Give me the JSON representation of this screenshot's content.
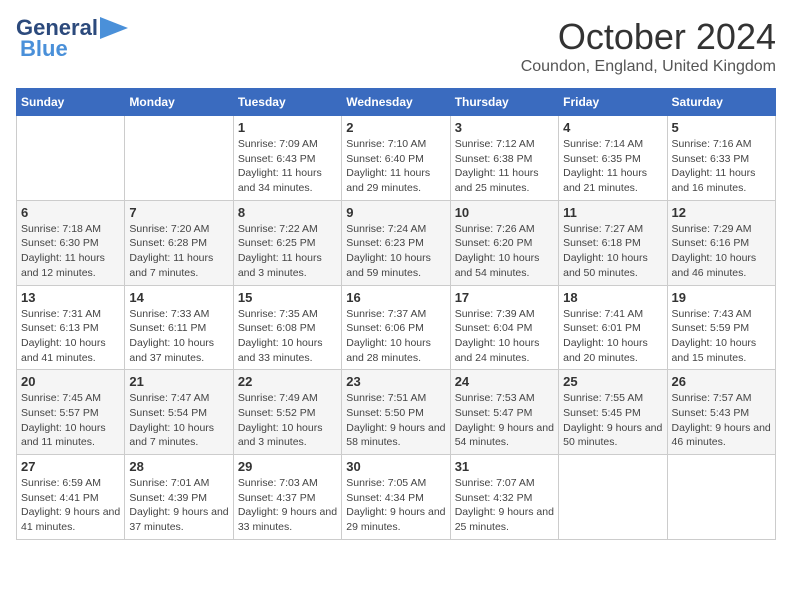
{
  "header": {
    "logo_line1": "General",
    "logo_line2": "Blue",
    "month_title": "October 2024",
    "location": "Coundon, England, United Kingdom"
  },
  "weekdays": [
    "Sunday",
    "Monday",
    "Tuesday",
    "Wednesday",
    "Thursday",
    "Friday",
    "Saturday"
  ],
  "weeks": [
    [
      {
        "day": "",
        "sunrise": "",
        "sunset": "",
        "daylight": ""
      },
      {
        "day": "",
        "sunrise": "",
        "sunset": "",
        "daylight": ""
      },
      {
        "day": "1",
        "sunrise": "Sunrise: 7:09 AM",
        "sunset": "Sunset: 6:43 PM",
        "daylight": "Daylight: 11 hours and 34 minutes."
      },
      {
        "day": "2",
        "sunrise": "Sunrise: 7:10 AM",
        "sunset": "Sunset: 6:40 PM",
        "daylight": "Daylight: 11 hours and 29 minutes."
      },
      {
        "day": "3",
        "sunrise": "Sunrise: 7:12 AM",
        "sunset": "Sunset: 6:38 PM",
        "daylight": "Daylight: 11 hours and 25 minutes."
      },
      {
        "day": "4",
        "sunrise": "Sunrise: 7:14 AM",
        "sunset": "Sunset: 6:35 PM",
        "daylight": "Daylight: 11 hours and 21 minutes."
      },
      {
        "day": "5",
        "sunrise": "Sunrise: 7:16 AM",
        "sunset": "Sunset: 6:33 PM",
        "daylight": "Daylight: 11 hours and 16 minutes."
      }
    ],
    [
      {
        "day": "6",
        "sunrise": "Sunrise: 7:18 AM",
        "sunset": "Sunset: 6:30 PM",
        "daylight": "Daylight: 11 hours and 12 minutes."
      },
      {
        "day": "7",
        "sunrise": "Sunrise: 7:20 AM",
        "sunset": "Sunset: 6:28 PM",
        "daylight": "Daylight: 11 hours and 7 minutes."
      },
      {
        "day": "8",
        "sunrise": "Sunrise: 7:22 AM",
        "sunset": "Sunset: 6:25 PM",
        "daylight": "Daylight: 11 hours and 3 minutes."
      },
      {
        "day": "9",
        "sunrise": "Sunrise: 7:24 AM",
        "sunset": "Sunset: 6:23 PM",
        "daylight": "Daylight: 10 hours and 59 minutes."
      },
      {
        "day": "10",
        "sunrise": "Sunrise: 7:26 AM",
        "sunset": "Sunset: 6:20 PM",
        "daylight": "Daylight: 10 hours and 54 minutes."
      },
      {
        "day": "11",
        "sunrise": "Sunrise: 7:27 AM",
        "sunset": "Sunset: 6:18 PM",
        "daylight": "Daylight: 10 hours and 50 minutes."
      },
      {
        "day": "12",
        "sunrise": "Sunrise: 7:29 AM",
        "sunset": "Sunset: 6:16 PM",
        "daylight": "Daylight: 10 hours and 46 minutes."
      }
    ],
    [
      {
        "day": "13",
        "sunrise": "Sunrise: 7:31 AM",
        "sunset": "Sunset: 6:13 PM",
        "daylight": "Daylight: 10 hours and 41 minutes."
      },
      {
        "day": "14",
        "sunrise": "Sunrise: 7:33 AM",
        "sunset": "Sunset: 6:11 PM",
        "daylight": "Daylight: 10 hours and 37 minutes."
      },
      {
        "day": "15",
        "sunrise": "Sunrise: 7:35 AM",
        "sunset": "Sunset: 6:08 PM",
        "daylight": "Daylight: 10 hours and 33 minutes."
      },
      {
        "day": "16",
        "sunrise": "Sunrise: 7:37 AM",
        "sunset": "Sunset: 6:06 PM",
        "daylight": "Daylight: 10 hours and 28 minutes."
      },
      {
        "day": "17",
        "sunrise": "Sunrise: 7:39 AM",
        "sunset": "Sunset: 6:04 PM",
        "daylight": "Daylight: 10 hours and 24 minutes."
      },
      {
        "day": "18",
        "sunrise": "Sunrise: 7:41 AM",
        "sunset": "Sunset: 6:01 PM",
        "daylight": "Daylight: 10 hours and 20 minutes."
      },
      {
        "day": "19",
        "sunrise": "Sunrise: 7:43 AM",
        "sunset": "Sunset: 5:59 PM",
        "daylight": "Daylight: 10 hours and 15 minutes."
      }
    ],
    [
      {
        "day": "20",
        "sunrise": "Sunrise: 7:45 AM",
        "sunset": "Sunset: 5:57 PM",
        "daylight": "Daylight: 10 hours and 11 minutes."
      },
      {
        "day": "21",
        "sunrise": "Sunrise: 7:47 AM",
        "sunset": "Sunset: 5:54 PM",
        "daylight": "Daylight: 10 hours and 7 minutes."
      },
      {
        "day": "22",
        "sunrise": "Sunrise: 7:49 AM",
        "sunset": "Sunset: 5:52 PM",
        "daylight": "Daylight: 10 hours and 3 minutes."
      },
      {
        "day": "23",
        "sunrise": "Sunrise: 7:51 AM",
        "sunset": "Sunset: 5:50 PM",
        "daylight": "Daylight: 9 hours and 58 minutes."
      },
      {
        "day": "24",
        "sunrise": "Sunrise: 7:53 AM",
        "sunset": "Sunset: 5:47 PM",
        "daylight": "Daylight: 9 hours and 54 minutes."
      },
      {
        "day": "25",
        "sunrise": "Sunrise: 7:55 AM",
        "sunset": "Sunset: 5:45 PM",
        "daylight": "Daylight: 9 hours and 50 minutes."
      },
      {
        "day": "26",
        "sunrise": "Sunrise: 7:57 AM",
        "sunset": "Sunset: 5:43 PM",
        "daylight": "Daylight: 9 hours and 46 minutes."
      }
    ],
    [
      {
        "day": "27",
        "sunrise": "Sunrise: 6:59 AM",
        "sunset": "Sunset: 4:41 PM",
        "daylight": "Daylight: 9 hours and 41 minutes."
      },
      {
        "day": "28",
        "sunrise": "Sunrise: 7:01 AM",
        "sunset": "Sunset: 4:39 PM",
        "daylight": "Daylight: 9 hours and 37 minutes."
      },
      {
        "day": "29",
        "sunrise": "Sunrise: 7:03 AM",
        "sunset": "Sunset: 4:37 PM",
        "daylight": "Daylight: 9 hours and 33 minutes."
      },
      {
        "day": "30",
        "sunrise": "Sunrise: 7:05 AM",
        "sunset": "Sunset: 4:34 PM",
        "daylight": "Daylight: 9 hours and 29 minutes."
      },
      {
        "day": "31",
        "sunrise": "Sunrise: 7:07 AM",
        "sunset": "Sunset: 4:32 PM",
        "daylight": "Daylight: 9 hours and 25 minutes."
      },
      {
        "day": "",
        "sunrise": "",
        "sunset": "",
        "daylight": ""
      },
      {
        "day": "",
        "sunrise": "",
        "sunset": "",
        "daylight": ""
      }
    ]
  ]
}
